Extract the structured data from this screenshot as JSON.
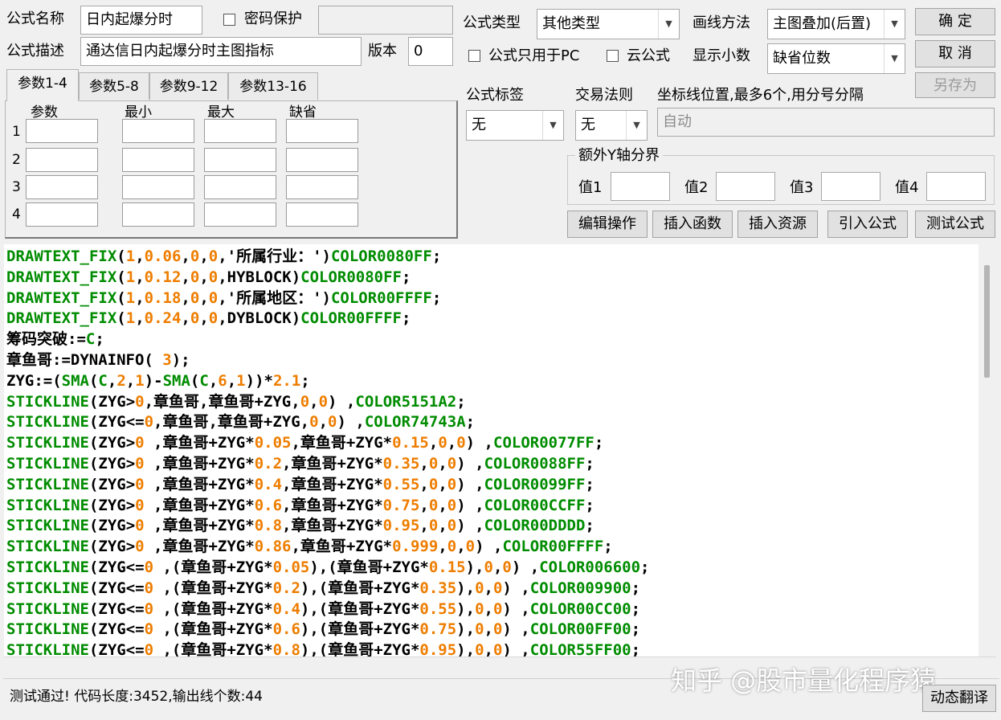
{
  "form": {
    "name_label": "公式名称",
    "name_value": "日内起爆分时",
    "password_label": "密码保护",
    "desc_label": "公式描述",
    "desc_value": "通达信日内起爆分时主图指标",
    "version_label": "版本",
    "version_value": "0"
  },
  "param_tabs": [
    "参数1-4",
    "参数5-8",
    "参数9-12",
    "参数13-16"
  ],
  "param_table": {
    "headers": [
      "参数",
      "最小",
      "最大",
      "缺省"
    ],
    "rows": [
      "1",
      "2",
      "3",
      "4"
    ]
  },
  "settings": {
    "type_label": "公式类型",
    "type_value": "其他类型",
    "draw_label": "画线方法",
    "draw_value": "主图叠加(后置)",
    "pc_only_label": "公式只用于PC",
    "cloud_label": "云公式",
    "decimals_label": "显示小数",
    "decimals_value": "缺省位数",
    "tag_label": "公式标签",
    "tag_value": "无",
    "rule_label": "交易法则",
    "rule_value": "无",
    "coord_label": "坐标线位置,最多6个,用分号分隔",
    "coord_value": "自动",
    "yaxis_group": "额外Y轴分界",
    "val1": "值1",
    "val2": "值2",
    "val3": "值3",
    "val4": "值4"
  },
  "buttons": {
    "ok": "确  定",
    "cancel": "取  消",
    "save_as": "另存为",
    "edit_ops": "编辑操作",
    "insert_func": "插入函数",
    "insert_res": "插入资源",
    "import_formula": "引入公式",
    "test_formula": "测试公式",
    "dyn_translate": "动态翻译"
  },
  "code_lines": [
    [
      [
        "k",
        "DRAWTEXT_FIX"
      ],
      [
        "p",
        "("
      ],
      [
        "n",
        "1"
      ],
      [
        "p",
        ","
      ],
      [
        "n",
        "0.06"
      ],
      [
        "p",
        ","
      ],
      [
        "n",
        "0"
      ],
      [
        "p",
        ","
      ],
      [
        "n",
        "0"
      ],
      [
        "p",
        ",'所属行业：')"
      ],
      [
        "k",
        "COLOR0080FF"
      ],
      [
        "p",
        ";"
      ]
    ],
    [
      [
        "k",
        "DRAWTEXT_FIX"
      ],
      [
        "p",
        "("
      ],
      [
        "n",
        "1"
      ],
      [
        "p",
        ","
      ],
      [
        "n",
        "0.12"
      ],
      [
        "p",
        ","
      ],
      [
        "n",
        "0"
      ],
      [
        "p",
        ","
      ],
      [
        "n",
        "0"
      ],
      [
        "p",
        ",HYBLOCK)"
      ],
      [
        "k",
        "COLOR0080FF"
      ],
      [
        "p",
        ";"
      ]
    ],
    [
      [
        "k",
        "DRAWTEXT_FIX"
      ],
      [
        "p",
        "("
      ],
      [
        "n",
        "1"
      ],
      [
        "p",
        ","
      ],
      [
        "n",
        "0.18"
      ],
      [
        "p",
        ","
      ],
      [
        "n",
        "0"
      ],
      [
        "p",
        ","
      ],
      [
        "n",
        "0"
      ],
      [
        "p",
        ",'所属地区：')"
      ],
      [
        "k",
        "COLOR00FFFF"
      ],
      [
        "p",
        ";"
      ]
    ],
    [
      [
        "k",
        "DRAWTEXT_FIX"
      ],
      [
        "p",
        "("
      ],
      [
        "n",
        "1"
      ],
      [
        "p",
        ","
      ],
      [
        "n",
        "0.24"
      ],
      [
        "p",
        ","
      ],
      [
        "n",
        "0"
      ],
      [
        "p",
        ","
      ],
      [
        "n",
        "0"
      ],
      [
        "p",
        ",DYBLOCK)"
      ],
      [
        "k",
        "COLOR00FFFF"
      ],
      [
        "p",
        ";"
      ]
    ],
    [
      [
        "p",
        "筹码突破:="
      ],
      [
        "k",
        "C"
      ],
      [
        "p",
        ";"
      ]
    ],
    [
      [
        "p",
        "章鱼哥:=DYNAINFO( "
      ],
      [
        "n",
        "3"
      ],
      [
        "p",
        ");"
      ]
    ],
    [
      [
        "p",
        "ZYG:=("
      ],
      [
        "k",
        "SMA"
      ],
      [
        "p",
        "("
      ],
      [
        "k",
        "C"
      ],
      [
        "p",
        ","
      ],
      [
        "n",
        "2"
      ],
      [
        "p",
        ","
      ],
      [
        "n",
        "1"
      ],
      [
        "p",
        ")-"
      ],
      [
        "k",
        "SMA"
      ],
      [
        "p",
        "("
      ],
      [
        "k",
        "C"
      ],
      [
        "p",
        ","
      ],
      [
        "n",
        "6"
      ],
      [
        "p",
        ","
      ],
      [
        "n",
        "1"
      ],
      [
        "p",
        "))*"
      ],
      [
        "n",
        "2.1"
      ],
      [
        "p",
        ";"
      ]
    ],
    [
      [
        "k",
        "STICKLINE"
      ],
      [
        "p",
        "(ZYG>"
      ],
      [
        "n",
        "0"
      ],
      [
        "p",
        ",章鱼哥,章鱼哥+ZYG,"
      ],
      [
        "n",
        "0"
      ],
      [
        "p",
        ","
      ],
      [
        "n",
        "0"
      ],
      [
        "p",
        ") ,"
      ],
      [
        "k",
        "COLOR5151A2"
      ],
      [
        "p",
        ";"
      ]
    ],
    [
      [
        "k",
        "STICKLINE"
      ],
      [
        "p",
        "(ZYG<="
      ],
      [
        "n",
        "0"
      ],
      [
        "p",
        ",章鱼哥,章鱼哥+ZYG,"
      ],
      [
        "n",
        "0"
      ],
      [
        "p",
        ","
      ],
      [
        "n",
        "0"
      ],
      [
        "p",
        ") ,"
      ],
      [
        "k",
        "COLOR74743A"
      ],
      [
        "p",
        ";"
      ]
    ],
    [
      [
        "k",
        "STICKLINE"
      ],
      [
        "p",
        "(ZYG>"
      ],
      [
        "n",
        "0"
      ],
      [
        "p",
        " ,章鱼哥+ZYG*"
      ],
      [
        "n",
        "0.05"
      ],
      [
        "p",
        ",章鱼哥+ZYG*"
      ],
      [
        "n",
        "0.15"
      ],
      [
        "p",
        ","
      ],
      [
        "n",
        "0"
      ],
      [
        "p",
        ","
      ],
      [
        "n",
        "0"
      ],
      [
        "p",
        ") ,"
      ],
      [
        "k",
        "COLOR0077FF"
      ],
      [
        "p",
        ";"
      ]
    ],
    [
      [
        "k",
        "STICKLINE"
      ],
      [
        "p",
        "(ZYG>"
      ],
      [
        "n",
        "0"
      ],
      [
        "p",
        " ,章鱼哥+ZYG*"
      ],
      [
        "n",
        "0.2"
      ],
      [
        "p",
        ",章鱼哥+ZYG*"
      ],
      [
        "n",
        "0.35"
      ],
      [
        "p",
        ","
      ],
      [
        "n",
        "0"
      ],
      [
        "p",
        ","
      ],
      [
        "n",
        "0"
      ],
      [
        "p",
        ") ,"
      ],
      [
        "k",
        "COLOR0088FF"
      ],
      [
        "p",
        ";"
      ]
    ],
    [
      [
        "k",
        "STICKLINE"
      ],
      [
        "p",
        "(ZYG>"
      ],
      [
        "n",
        "0"
      ],
      [
        "p",
        " ,章鱼哥+ZYG*"
      ],
      [
        "n",
        "0.4"
      ],
      [
        "p",
        ",章鱼哥+ZYG*"
      ],
      [
        "n",
        "0.55"
      ],
      [
        "p",
        ","
      ],
      [
        "n",
        "0"
      ],
      [
        "p",
        ","
      ],
      [
        "n",
        "0"
      ],
      [
        "p",
        ") ,"
      ],
      [
        "k",
        "COLOR0099FF"
      ],
      [
        "p",
        ";"
      ]
    ],
    [
      [
        "k",
        "STICKLINE"
      ],
      [
        "p",
        "(ZYG>"
      ],
      [
        "n",
        "0"
      ],
      [
        "p",
        " ,章鱼哥+ZYG*"
      ],
      [
        "n",
        "0.6"
      ],
      [
        "p",
        ",章鱼哥+ZYG*"
      ],
      [
        "n",
        "0.75"
      ],
      [
        "p",
        ","
      ],
      [
        "n",
        "0"
      ],
      [
        "p",
        ","
      ],
      [
        "n",
        "0"
      ],
      [
        "p",
        ") ,"
      ],
      [
        "k",
        "COLOR00CCFF"
      ],
      [
        "p",
        ";"
      ]
    ],
    [
      [
        "k",
        "STICKLINE"
      ],
      [
        "p",
        "(ZYG>"
      ],
      [
        "n",
        "0"
      ],
      [
        "p",
        " ,章鱼哥+ZYG*"
      ],
      [
        "n",
        "0.8"
      ],
      [
        "p",
        ",章鱼哥+ZYG*"
      ],
      [
        "n",
        "0.95"
      ],
      [
        "p",
        ","
      ],
      [
        "n",
        "0"
      ],
      [
        "p",
        ","
      ],
      [
        "n",
        "0"
      ],
      [
        "p",
        ") ,"
      ],
      [
        "k",
        "COLOR00DDDD"
      ],
      [
        "p",
        ";"
      ]
    ],
    [
      [
        "k",
        "STICKLINE"
      ],
      [
        "p",
        "(ZYG>"
      ],
      [
        "n",
        "0"
      ],
      [
        "p",
        " ,章鱼哥+ZYG*"
      ],
      [
        "n",
        "0.86"
      ],
      [
        "p",
        ",章鱼哥+ZYG*"
      ],
      [
        "n",
        "0.999"
      ],
      [
        "p",
        ","
      ],
      [
        "n",
        "0"
      ],
      [
        "p",
        ","
      ],
      [
        "n",
        "0"
      ],
      [
        "p",
        ") ,"
      ],
      [
        "k",
        "COLOR00FFFF"
      ],
      [
        "p",
        ";"
      ]
    ],
    [
      [
        "k",
        "STICKLINE"
      ],
      [
        "p",
        "(ZYG<="
      ],
      [
        "n",
        "0"
      ],
      [
        "p",
        " ,(章鱼哥+ZYG*"
      ],
      [
        "n",
        "0.05"
      ],
      [
        "p",
        "),(章鱼哥+ZYG*"
      ],
      [
        "n",
        "0.15"
      ],
      [
        "p",
        "),"
      ],
      [
        "n",
        "0"
      ],
      [
        "p",
        ","
      ],
      [
        "n",
        "0"
      ],
      [
        "p",
        ") ,"
      ],
      [
        "k",
        "COLOR006600"
      ],
      [
        "p",
        ";"
      ]
    ],
    [
      [
        "k",
        "STICKLINE"
      ],
      [
        "p",
        "(ZYG<="
      ],
      [
        "n",
        "0"
      ],
      [
        "p",
        " ,(章鱼哥+ZYG*"
      ],
      [
        "n",
        "0.2"
      ],
      [
        "p",
        "),(章鱼哥+ZYG*"
      ],
      [
        "n",
        "0.35"
      ],
      [
        "p",
        "),"
      ],
      [
        "n",
        "0"
      ],
      [
        "p",
        ","
      ],
      [
        "n",
        "0"
      ],
      [
        "p",
        ") ,"
      ],
      [
        "k",
        "COLOR009900"
      ],
      [
        "p",
        ";"
      ]
    ],
    [
      [
        "k",
        "STICKLINE"
      ],
      [
        "p",
        "(ZYG<="
      ],
      [
        "n",
        "0"
      ],
      [
        "p",
        " ,(章鱼哥+ZYG*"
      ],
      [
        "n",
        "0.4"
      ],
      [
        "p",
        "),(章鱼哥+ZYG*"
      ],
      [
        "n",
        "0.55"
      ],
      [
        "p",
        "),"
      ],
      [
        "n",
        "0"
      ],
      [
        "p",
        ","
      ],
      [
        "n",
        "0"
      ],
      [
        "p",
        ") ,"
      ],
      [
        "k",
        "COLOR00CC00"
      ],
      [
        "p",
        ";"
      ]
    ],
    [
      [
        "k",
        "STICKLINE"
      ],
      [
        "p",
        "(ZYG<="
      ],
      [
        "n",
        "0"
      ],
      [
        "p",
        " ,(章鱼哥+ZYG*"
      ],
      [
        "n",
        "0.6"
      ],
      [
        "p",
        "),(章鱼哥+ZYG*"
      ],
      [
        "n",
        "0.75"
      ],
      [
        "p",
        "),"
      ],
      [
        "n",
        "0"
      ],
      [
        "p",
        ","
      ],
      [
        "n",
        "0"
      ],
      [
        "p",
        ") ,"
      ],
      [
        "k",
        "COLOR00FF00"
      ],
      [
        "p",
        ";"
      ]
    ],
    [
      [
        "k",
        "STICKLINE"
      ],
      [
        "p",
        "(ZYG<="
      ],
      [
        "n",
        "0"
      ],
      [
        "p",
        " ,(章鱼哥+ZYG*"
      ],
      [
        "n",
        "0.8"
      ],
      [
        "p",
        "),(章鱼哥+ZYG*"
      ],
      [
        "n",
        "0.95"
      ],
      [
        "p",
        "),"
      ],
      [
        "n",
        "0"
      ],
      [
        "p",
        ","
      ],
      [
        "n",
        "0"
      ],
      [
        "p",
        ") ,"
      ],
      [
        "k",
        "COLOR55FF00"
      ],
      [
        "p",
        ";"
      ]
    ]
  ],
  "status": {
    "text": "测试通过! 代码长度:3452,输出线个数:44",
    "watermark": "知乎 @股市量化程序猿"
  },
  "colors": {
    "keyword": "#008c00",
    "number": "#ee7d00",
    "plain": "#000000"
  }
}
